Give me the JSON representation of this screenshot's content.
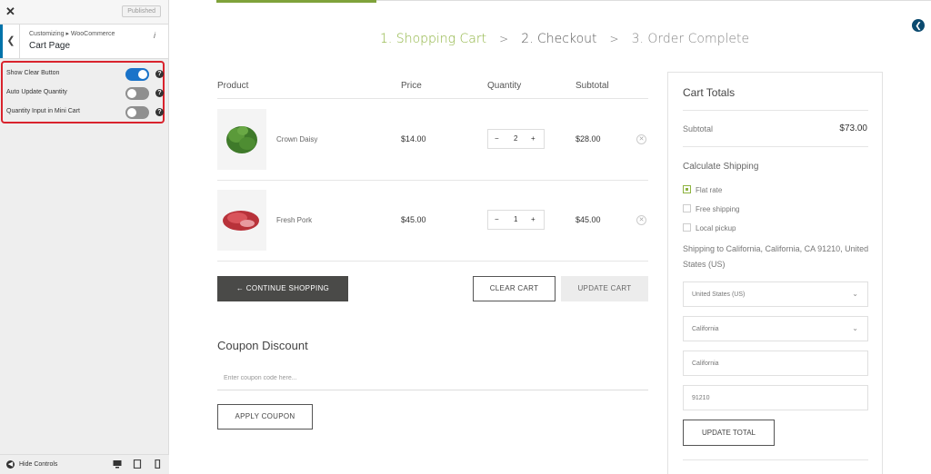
{
  "customizer": {
    "published_label": "Published",
    "breadcrumb": "Customizing ▸ WooCommerce",
    "section_title": "Cart Page",
    "options": [
      {
        "label": "Show Clear Button",
        "enabled": true
      },
      {
        "label": "Auto Update Quantity",
        "enabled": false
      },
      {
        "label": "Quantity Input in Mini Cart",
        "enabled": false
      }
    ],
    "hide_controls_label": "Hide Controls"
  },
  "steps": [
    {
      "label": "1. Shopping Cart"
    },
    {
      "label": "2. Checkout"
    },
    {
      "label": "3. Order Complete"
    }
  ],
  "table": {
    "headers": {
      "product": "Product",
      "price": "Price",
      "quantity": "Quantity",
      "subtotal": "Subtotal"
    },
    "rows": [
      {
        "name": "Crown Daisy",
        "price": "$14.00",
        "qty": "2",
        "subtotal": "$28.00"
      },
      {
        "name": "Fresh Pork",
        "price": "$45.00",
        "qty": "1",
        "subtotal": "$45.00"
      }
    ]
  },
  "buttons": {
    "continue_shopping": "CONTINUE SHOPPING",
    "clear_cart": "CLEAR CART",
    "update_cart": "UPDATE CART",
    "apply_coupon": "APPLY COUPON",
    "update_total": "UPDATE TOTAL"
  },
  "coupon": {
    "title": "Coupon Discount",
    "placeholder": "Enter coupon code here..."
  },
  "totals": {
    "title": "Cart Totals",
    "subtotal_label": "Subtotal",
    "subtotal_value": "$73.00",
    "calc_shipping": "Calculate Shipping",
    "shipping_options": [
      {
        "label": "Flat rate",
        "checked": true
      },
      {
        "label": "Free shipping",
        "checked": false
      },
      {
        "label": "Local pickup",
        "checked": false
      }
    ],
    "shipping_to": "Shipping to California, California, CA 91210, United States (US)",
    "country": "United States (US)",
    "state": "California",
    "city": "California",
    "zip": "91210"
  }
}
